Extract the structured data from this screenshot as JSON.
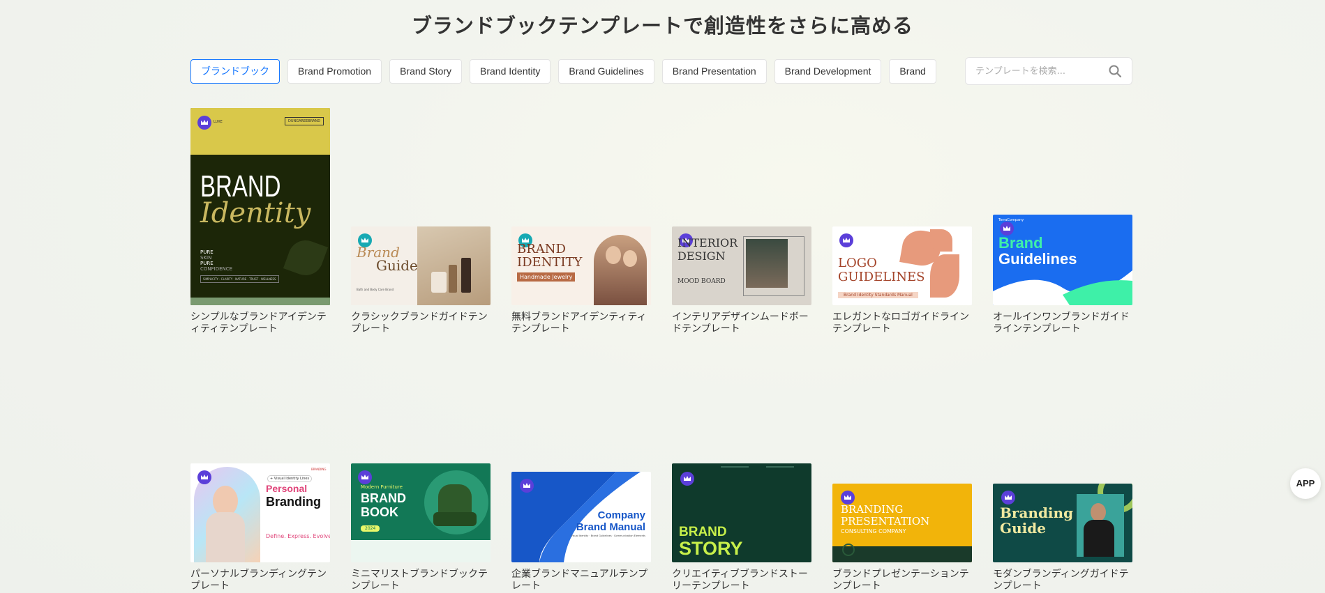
{
  "header": {
    "title": "ブランドブックテンプレートで創造性をさらに高める"
  },
  "tabs": [
    {
      "label": "ブランドブック"
    },
    {
      "label": "Brand Promotion"
    },
    {
      "label": "Brand Story"
    },
    {
      "label": "Brand Identity"
    },
    {
      "label": "Brand Guidelines"
    },
    {
      "label": "Brand Presentation"
    },
    {
      "label": "Brand Development"
    },
    {
      "label": "Brand"
    }
  ],
  "search": {
    "placeholder": "テンプレートを検索...",
    "icon": "search-icon"
  },
  "templates": [
    {
      "caption": "シンプルなブランドアイデンティティテンプレート",
      "thumb": {
        "t1": "DUNGAREEBRAND",
        "t2": "BRAND",
        "t3": "Identity",
        "t4": "PURE",
        "t5": "SKIN",
        "t6": "PURE",
        "t7": "CONFIDENCE",
        "t8": "SIMPLICITY · CLARITY · NATURE · TRUST · WELLNESS",
        "t9": "LUXE"
      }
    },
    {
      "caption": "クラシックブランドガイドテンプレート",
      "thumb": {
        "t1": "Brand",
        "t2": "Guide",
        "t3": "Bath and Body Care Brand"
      }
    },
    {
      "caption": "無料ブランドアイデンティティテンプレート",
      "thumb": {
        "t1": "BRAND",
        "t2": "IDENTITY",
        "t3": "Handmade Jewelry"
      }
    },
    {
      "caption": "インテリアデザインムードボードテンプレート",
      "thumb": {
        "t1": "INTERIOR",
        "t2": "DESIGN",
        "t3": "MOOD BOARD"
      }
    },
    {
      "caption": "エレガントなロゴガイドラインテンプレート",
      "thumb": {
        "t1": "LOGO",
        "t2": "GUIDELINES",
        "t3": "Brand Identity Standards Manual"
      }
    },
    {
      "caption": "オールインワンブランドガイドラインテンプレート",
      "thumb": {
        "t1": "TerraCompany",
        "t2": "Brand",
        "t3": "Guidelines"
      }
    },
    {
      "caption": "パーソナルブランディングテンプレート",
      "thumb": {
        "t1": "Personal",
        "t2": "Branding",
        "t3": "Define. Express. Evolve.",
        "t4": "+ Visual Identity Lines",
        "t5": "BRANDING"
      }
    },
    {
      "caption": "ミニマリストブランドブックテンプレート",
      "thumb": {
        "t1": "Modern Furniture",
        "t2": "BRAND",
        "t3": "BOOK",
        "t4": "2024"
      }
    },
    {
      "caption": "企業ブランドマニュアルテンプレート",
      "thumb": {
        "t1": "Company",
        "t2": "Brand Manual",
        "t3": "Visual Identity · Brand Guidelines · Communication Elements"
      }
    },
    {
      "caption": "クリエイティブブランドストーリーテンプレート",
      "thumb": {
        "t1": "BRAND",
        "t2": "STORY"
      }
    },
    {
      "caption": "ブランドプレゼンテーションテンプレート",
      "thumb": {
        "t1": "BRANDING",
        "t2": "PRESENTATION",
        "t3": "CONSULTING COMPANY"
      }
    },
    {
      "caption": "モダンブランディングガイドテンプレート",
      "thumb": {
        "t1": "Branding",
        "t2": "Guide"
      }
    }
  ],
  "app_button": {
    "label": "APP"
  }
}
